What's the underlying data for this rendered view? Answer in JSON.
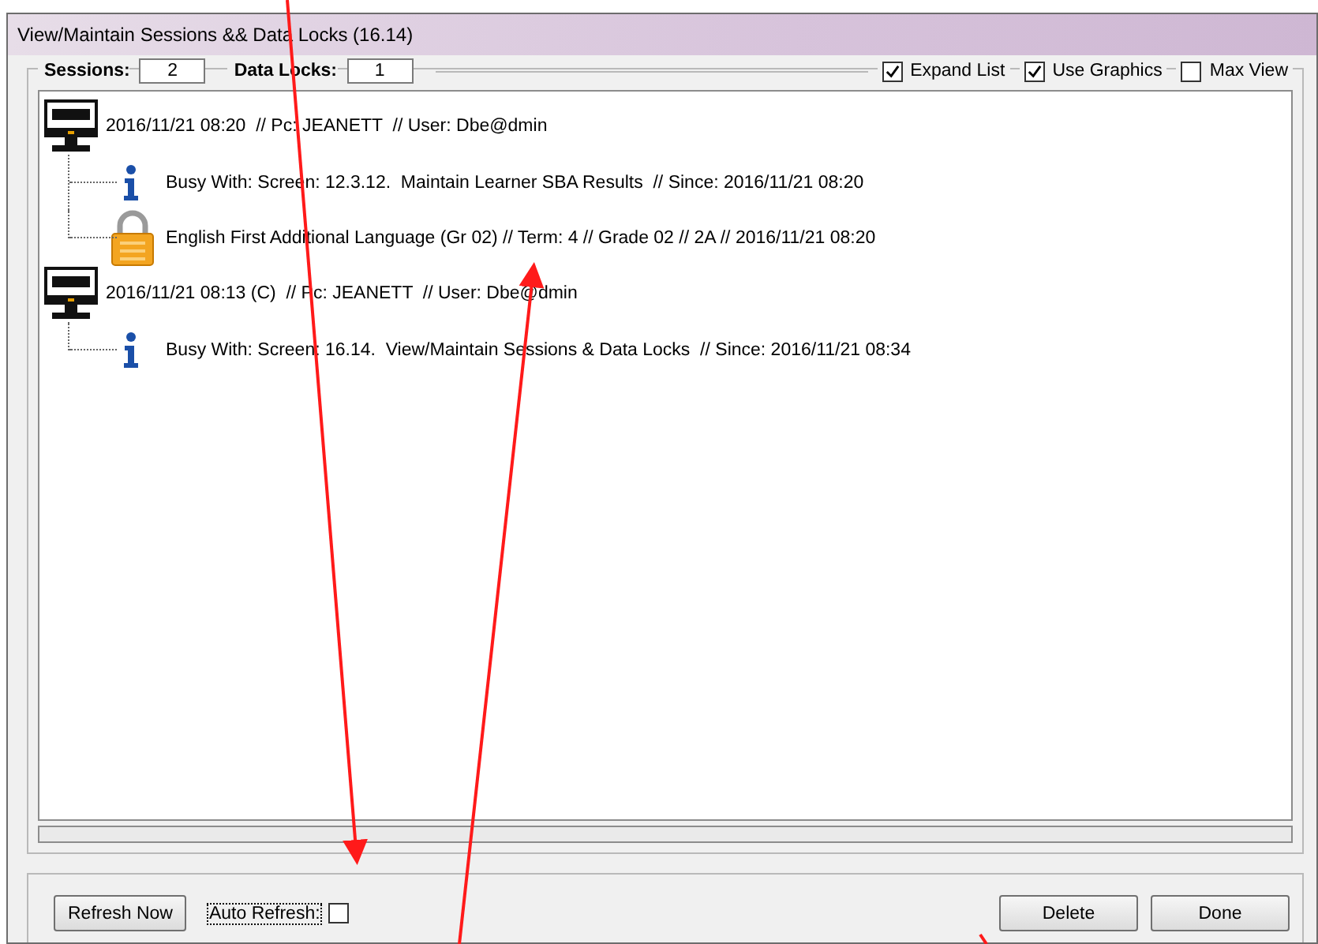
{
  "window": {
    "title": "View/Maintain Sessions && Data Locks (16.14)"
  },
  "counts": {
    "sessions_label": "Sessions:",
    "sessions": "2",
    "locks_label": "Data Locks:",
    "locks": "1"
  },
  "options": [
    {
      "label": "Expand List",
      "checked": true
    },
    {
      "label": "Use Graphics",
      "checked": true
    },
    {
      "label": "Max View",
      "checked": false
    }
  ],
  "sessions": [
    {
      "text": "2016/11/21 08:20  // Pc: JEANETT  // User: Dbe@dmin",
      "children": [
        {
          "kind": "info",
          "text": "Busy With: Screen: 12.3.12.  Maintain Learner SBA Results  // Since: 2016/11/21 08:20"
        },
        {
          "kind": "lock",
          "text": "English First Additional Language (Gr 02) // Term: 4 // Grade 02 // 2A // 2016/11/21 08:20"
        }
      ]
    },
    {
      "text": "2016/11/21 08:13 (C)  // Pc: JEANETT  // User: Dbe@dmin",
      "children": [
        {
          "kind": "info",
          "text": "Busy With: Screen: 16.14.  View/Maintain Sessions & Data Locks  // Since: 2016/11/21 08:34"
        }
      ]
    }
  ],
  "footer": {
    "refresh_button": "Refresh Now",
    "auto_refresh": {
      "label": "Auto Refresh:",
      "checked": false
    },
    "buttons": [
      "Delete",
      "Done"
    ]
  }
}
